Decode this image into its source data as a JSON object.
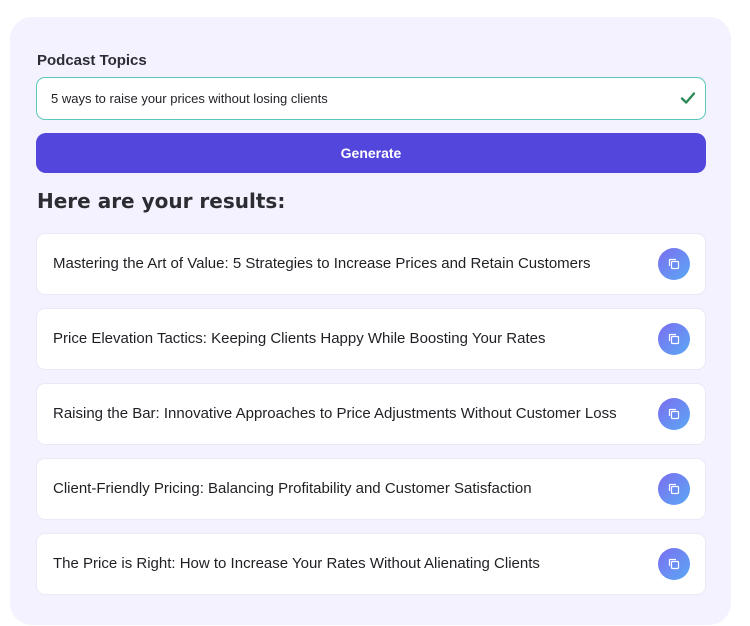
{
  "form": {
    "label": "Podcast Topics",
    "input_value": "5 ways to raise your prices without losing clients",
    "generate_label": "Generate"
  },
  "results": {
    "heading": "Here are your results:",
    "items": [
      {
        "text": "Mastering the Art of Value: 5 Strategies to Increase Prices and Retain Customers",
        "icon": "copy-icon"
      },
      {
        "text": "Price Elevation Tactics: Keeping Clients Happy While Boosting Your Rates",
        "icon": "copy-icon"
      },
      {
        "text": "Raising the Bar: Innovative Approaches to Price Adjustments Without Customer Loss",
        "icon": "copy-icon"
      },
      {
        "text": "Client-Friendly Pricing: Balancing Profitability and Customer Satisfaction",
        "icon": "copy-icon"
      },
      {
        "text": "The Price is Right: How to Increase Your Rates Without Alienating Clients",
        "icon": "copy-icon"
      }
    ]
  },
  "colors": {
    "accent": "#5246dd",
    "valid_border": "#5cc8ba",
    "check": "#2e8b57",
    "card_background": "#f4f2fe"
  }
}
